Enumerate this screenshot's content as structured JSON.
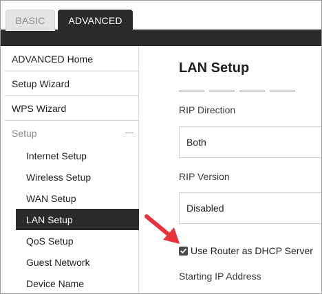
{
  "tabs": [
    {
      "label": "BASIC",
      "active": false
    },
    {
      "label": "ADVANCED",
      "active": true
    }
  ],
  "sidebar": {
    "items": [
      {
        "label": "ADVANCED Home"
      },
      {
        "label": "Setup Wizard"
      },
      {
        "label": "WPS Wizard"
      }
    ],
    "section": {
      "label": "Setup",
      "collapse_icon": "minus-icon"
    },
    "subitems": [
      {
        "label": "Internet Setup"
      },
      {
        "label": "Wireless Setup"
      },
      {
        "label": "WAN Setup"
      },
      {
        "label": "LAN Setup",
        "active": true
      },
      {
        "label": "QoS Setup"
      },
      {
        "label": "Guest Network"
      },
      {
        "label": "Device Name"
      }
    ]
  },
  "main": {
    "title": "LAN Setup",
    "rip_direction": {
      "label": "RIP Direction",
      "value": "Both"
    },
    "rip_version": {
      "label": "RIP Version",
      "value": "Disabled"
    },
    "dhcp": {
      "label": "Use Router as DHCP Server",
      "checked": true
    },
    "starting_ip": {
      "label": "Starting IP Address"
    }
  },
  "colors": {
    "dark": "#2b2b2b",
    "annotation_arrow": "#e8323c"
  },
  "icons": {
    "annotation": "red-arrow-icon",
    "checkbox": "checkmark-icon"
  }
}
